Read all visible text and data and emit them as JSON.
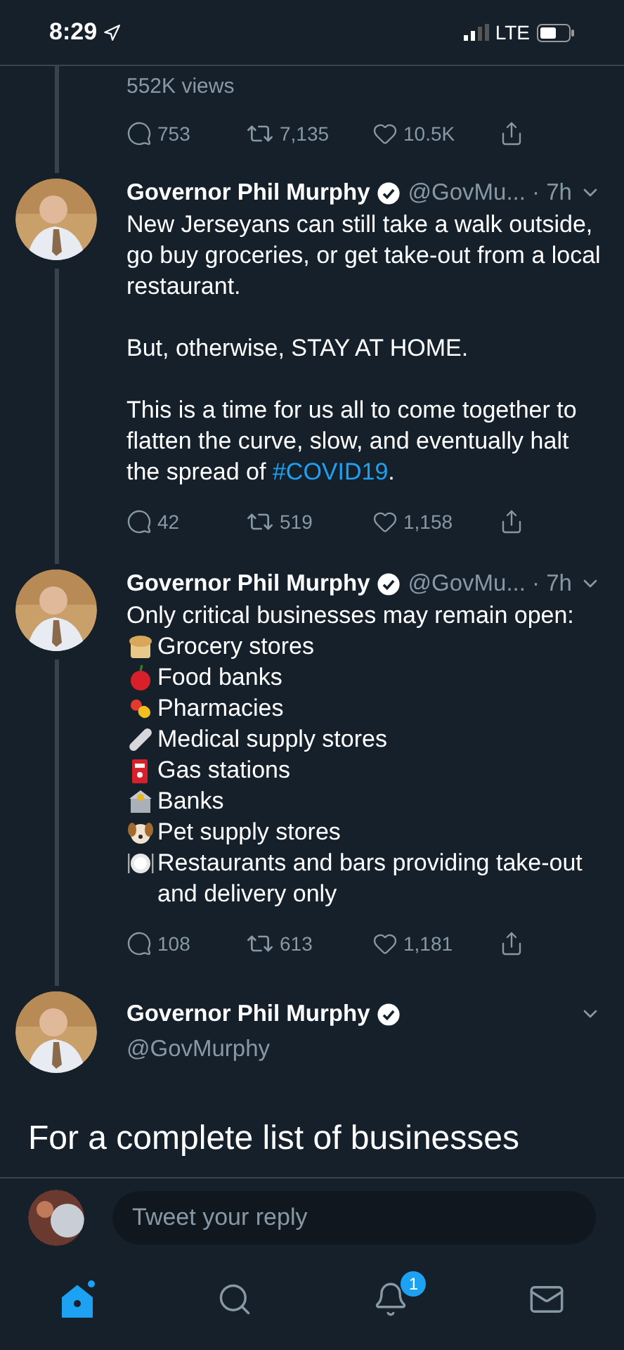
{
  "status_bar": {
    "time": "8:29",
    "network": "LTE"
  },
  "tweets": [
    {
      "kind": "tail",
      "views": "552K views",
      "replies": "753",
      "retweets": "7,135",
      "likes": "10.5K"
    },
    {
      "kind": "full",
      "name": "Governor Phil Murphy",
      "meta": "@GovMu... · 7h",
      "paragraphs": [
        {
          "text": "New Jerseyans can still take a walk outside, go buy groceries, or get take-out from a local restaurant."
        },
        {
          "text": "But, otherwise, STAY AT HOME."
        },
        {
          "text": "This is a time for us all to come together to flatten the curve, slow, and eventually halt the spread of ",
          "link": "#COVID19",
          "after": "."
        }
      ],
      "replies": "42",
      "retweets": "519",
      "likes": "1,158"
    },
    {
      "kind": "full",
      "name": "Governor Phil Murphy",
      "meta": "@GovMu... · 7h",
      "paragraphs": [
        {
          "text": "Only critical businesses may remain open:"
        }
      ],
      "items": [
        {
          "kind": "bread",
          "text": "Grocery stores"
        },
        {
          "kind": "apple",
          "text": "Food banks"
        },
        {
          "kind": "pill",
          "text": "Pharmacies"
        },
        {
          "kind": "bandage",
          "text": "Medical supply stores"
        },
        {
          "kind": "fuel",
          "text": "Gas stations"
        },
        {
          "kind": "bank",
          "text": "Banks"
        },
        {
          "kind": "dog",
          "text": "Pet supply stores"
        },
        {
          "kind": "plate",
          "text": "Restaurants and bars providing take-out and delivery only"
        }
      ],
      "replies": "108",
      "retweets": "613",
      "likes": "1,181"
    },
    {
      "kind": "focus",
      "name": "Governor Phil Murphy",
      "handle": "@GovMurphy",
      "lines": [
        "For a complete list of businesses"
      ]
    }
  ],
  "reply_bar": {
    "placeholder": "Tweet your reply"
  },
  "tab_bar": [
    {
      "kind": "home",
      "selected": true,
      "new_dot": true
    },
    {
      "kind": "search",
      "selected": false
    },
    {
      "kind": "bell",
      "selected": false,
      "badge": "1"
    },
    {
      "kind": "mail",
      "selected": false
    }
  ]
}
